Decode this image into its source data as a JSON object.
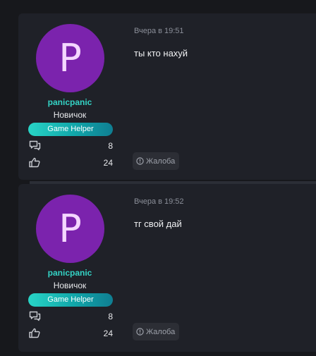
{
  "posts": [
    {
      "avatar_letter": "P",
      "username": "panicpanic",
      "user_title": "Новичок",
      "badge": "Game Helper",
      "messages_count": "8",
      "likes_count": "24",
      "date": "Вчера в 19:51",
      "message": "ты кто нахуй",
      "report_label": "Жалоба"
    },
    {
      "avatar_letter": "P",
      "username": "panicpanic",
      "user_title": "Новичок",
      "badge": "Game Helper",
      "messages_count": "8",
      "likes_count": "24",
      "date": "Вчера в 19:52",
      "message": "тг свой дай",
      "report_label": "Жалоба"
    }
  ],
  "colors": {
    "background": "#17181c",
    "card": "#1f2128",
    "avatar": "#7b23ad",
    "username": "#34d3c5",
    "badge_start": "#28d4c6",
    "badge_end": "#0f7e92"
  },
  "icons": [
    "messages-icon",
    "likes-icon",
    "report-icon"
  ]
}
